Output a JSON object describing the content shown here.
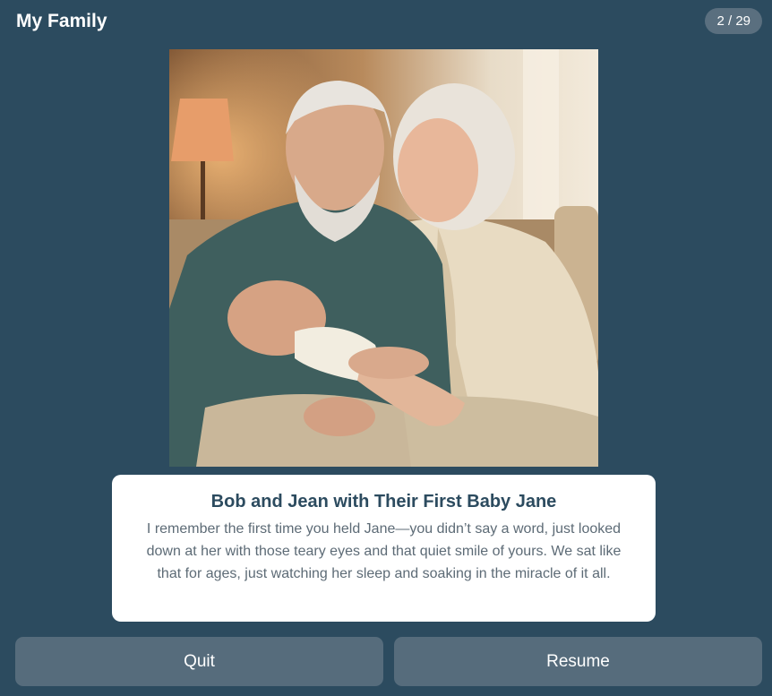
{
  "header": {
    "title": "My Family",
    "counter": "2 / 29"
  },
  "photo": {
    "icon": "family-photo"
  },
  "caption": {
    "title": "Bob and Jean with Their First Baby Jane",
    "body": "I remember the first time you held Jane—you didn’t say a word, just looked down at her with those teary eyes and that quiet smile of yours. We sat like that for ages, just watching her sleep and soaking in the miracle of it all."
  },
  "actions": {
    "quit_label": "Quit",
    "resume_label": "Resume"
  },
  "colors": {
    "background": "#2c4b5f",
    "button": "#566c7c",
    "card": "#ffffff",
    "title_text": "#2c4b5f"
  }
}
